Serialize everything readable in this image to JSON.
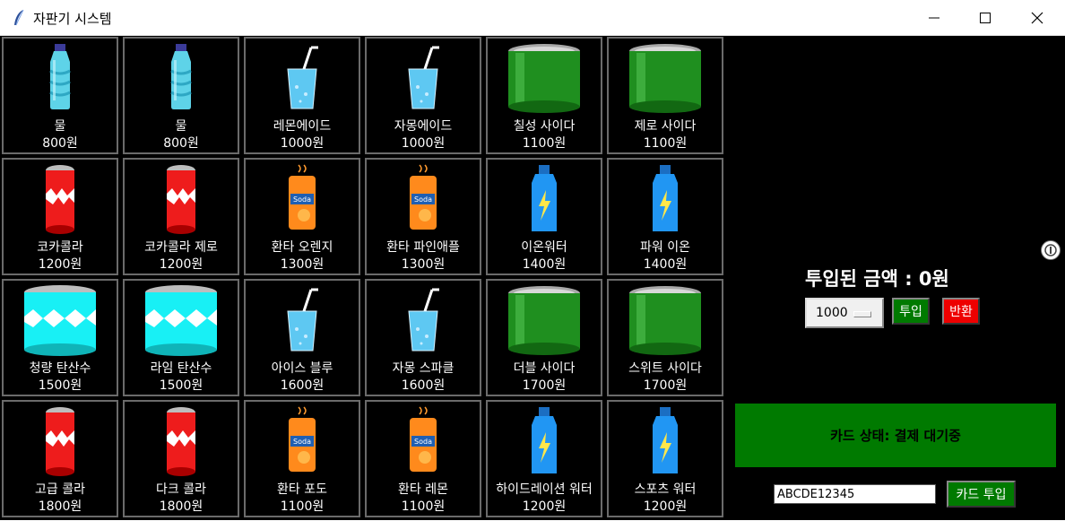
{
  "window": {
    "title": "자판기 시스템"
  },
  "products": [
    {
      "name": "물",
      "price": "800원",
      "icon": "water-bottle"
    },
    {
      "name": "물",
      "price": "800원",
      "icon": "water-bottle"
    },
    {
      "name": "레몬에이드",
      "price": "1000원",
      "icon": "cup-straw"
    },
    {
      "name": "자몽에이드",
      "price": "1000원",
      "icon": "cup-straw"
    },
    {
      "name": "칠성 사이다",
      "price": "1100원",
      "icon": "green-can"
    },
    {
      "name": "제로 사이다",
      "price": "1100원",
      "icon": "green-can"
    },
    {
      "name": "코카콜라",
      "price": "1200원",
      "icon": "red-can"
    },
    {
      "name": "코카콜라 제로",
      "price": "1200원",
      "icon": "red-can"
    },
    {
      "name": "환타 오렌지",
      "price": "1300원",
      "icon": "soda-can"
    },
    {
      "name": "환타 파인애플",
      "price": "1300원",
      "icon": "soda-can"
    },
    {
      "name": "이온워터",
      "price": "1400원",
      "icon": "sports-bottle"
    },
    {
      "name": "파워 이온",
      "price": "1400원",
      "icon": "sports-bottle"
    },
    {
      "name": "청량 탄산수",
      "price": "1500원",
      "icon": "cyan-can"
    },
    {
      "name": "라임 탄산수",
      "price": "1500원",
      "icon": "cyan-can"
    },
    {
      "name": "아이스 블루",
      "price": "1600원",
      "icon": "cup-straw"
    },
    {
      "name": "자몽 스파클",
      "price": "1600원",
      "icon": "cup-straw"
    },
    {
      "name": "더블 사이다",
      "price": "1700원",
      "icon": "green-can"
    },
    {
      "name": "스위트 사이다",
      "price": "1700원",
      "icon": "green-can"
    },
    {
      "name": "고급 콜라",
      "price": "1800원",
      "icon": "red-can"
    },
    {
      "name": "다크 콜라",
      "price": "1800원",
      "icon": "red-can"
    },
    {
      "name": "환타 포도",
      "price": "1100원",
      "icon": "soda-can"
    },
    {
      "name": "환타 레몬",
      "price": "1100원",
      "icon": "soda-can"
    },
    {
      "name": "하이드레이션 워터",
      "price": "1200원",
      "icon": "sports-bottle"
    },
    {
      "name": "스포츠 워터",
      "price": "1200원",
      "icon": "sports-bottle"
    }
  ],
  "panel": {
    "amount_text": "투입된 금액 :  0원",
    "amount_option": "1000",
    "insert_label": "투입",
    "return_label": "반환",
    "card_status": "카드 상태: 결제 대기중",
    "card_number": "ABCDE12345",
    "card_button": "카드 투입"
  },
  "colors": {
    "green": "#007a00",
    "red": "#ee0000",
    "background": "#000000"
  }
}
